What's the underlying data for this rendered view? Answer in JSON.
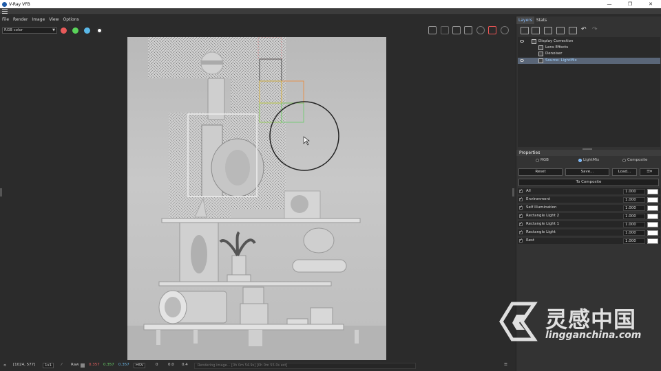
{
  "window": {
    "title": "V-Ray VFB"
  },
  "menu": [
    "File",
    "Render",
    "Image",
    "View",
    "Options"
  ],
  "toolbar": {
    "channel": "RGB color"
  },
  "right_panel": {
    "tabs": [
      "Layers",
      "Stats"
    ],
    "layers": [
      {
        "label": "Display Correction",
        "visible": true,
        "selected": false,
        "indent": 0
      },
      {
        "label": "Lens Effects",
        "visible": false,
        "selected": false,
        "indent": 1
      },
      {
        "label": "Denoiser",
        "visible": false,
        "selected": false,
        "indent": 1
      },
      {
        "label": "Source: LightMix",
        "visible": true,
        "selected": true,
        "indent": 1
      }
    ],
    "properties": {
      "title": "Properties",
      "modes": [
        "RGB",
        "LightMix",
        "Composite"
      ],
      "active_mode": "LightMix",
      "buttons": {
        "reset": "Reset",
        "save": "Save...",
        "load": "Load...",
        "to_composite": "To Composite"
      },
      "lights": [
        {
          "name": "All",
          "value": "1.000"
        },
        {
          "name": "Environment",
          "value": "1.000"
        },
        {
          "name": "Self Illumination",
          "value": "1.000"
        },
        {
          "name": "Rectangle Light 2",
          "value": "1.000"
        },
        {
          "name": "Rectangle Light 1",
          "value": "1.000"
        },
        {
          "name": "Rectangle Light",
          "value": "1.000"
        },
        {
          "name": "Rest",
          "value": "1.000"
        }
      ]
    }
  },
  "status": {
    "coords": "[1024, 577]",
    "zoom": "1x1",
    "raw_label": "Raw",
    "r": "0.357",
    "g": "0.357",
    "b": "0.357",
    "mode": "HSV",
    "h": "0",
    "s": "0.0",
    "v": "0.4",
    "progress_text": "Rendering image... [0h 0m 54.9s] [0h 0m 55.0s est]"
  },
  "watermark": {
    "cn": "灵感中国",
    "en": "lingganchina.com"
  },
  "colors": {
    "red_btn": "#e85a5a",
    "green_btn": "#5ad35a",
    "blue_btn": "#5ab8e8",
    "accent": "#8fc1ff"
  }
}
